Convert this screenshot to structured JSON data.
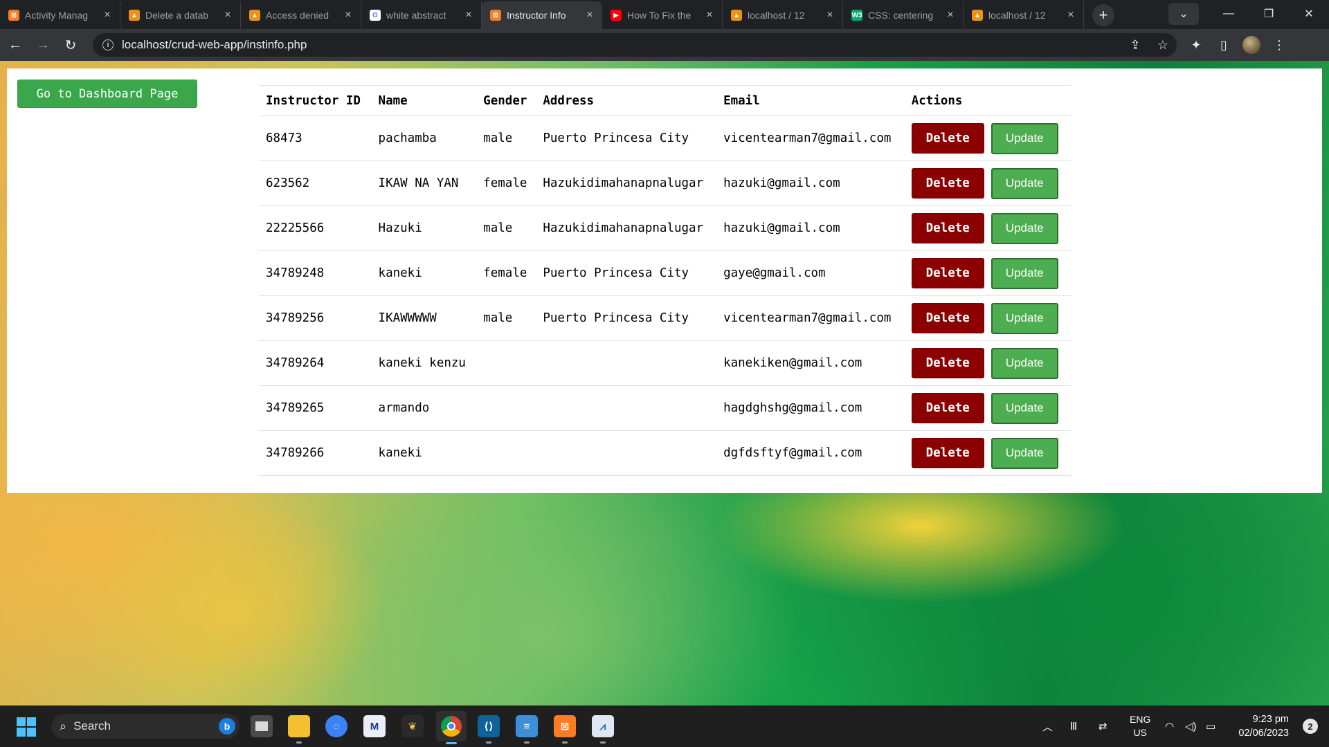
{
  "browser": {
    "tabs": [
      {
        "label": "Activity Manag",
        "favicon_color": "#fb7a24",
        "favicon_glyph": "⊠"
      },
      {
        "label": "Delete a datab",
        "favicon_color": "#f29111",
        "favicon_glyph": "▲"
      },
      {
        "label": "Access denied",
        "favicon_color": "#f29111",
        "favicon_glyph": "▲"
      },
      {
        "label": "white abstract",
        "favicon_color": "#ffffff",
        "favicon_glyph": "G"
      },
      {
        "label": "Instructor Info",
        "favicon_color": "#fb7a24",
        "favicon_glyph": "⊠",
        "active": true
      },
      {
        "label": "How To Fix the",
        "favicon_color": "#ff0000",
        "favicon_glyph": "▶"
      },
      {
        "label": "localhost / 12",
        "favicon_color": "#f29111",
        "favicon_glyph": "▲"
      },
      {
        "label": "CSS: centering",
        "favicon_color": "#04aa6d",
        "favicon_glyph": "W3"
      },
      {
        "label": "localhost / 12",
        "favicon_color": "#f29111",
        "favicon_glyph": "▲"
      }
    ],
    "url": "localhost/crud-web-app/instinfo.php"
  },
  "page": {
    "dashboard_button": "Go to Dashboard Page",
    "table": {
      "headers": [
        "Instructor ID",
        "Name",
        "Gender",
        "Address",
        "Email",
        "Actions"
      ],
      "rows": [
        {
          "id": "68473",
          "name": "pachamba",
          "gender": "male",
          "address": "Puerto Princesa City",
          "email": "vicentearman7@gmail.com"
        },
        {
          "id": "623562",
          "name": "IKAW NA YAN",
          "gender": "female",
          "address": "Hazukidimahanapnalugar",
          "email": "hazuki@gmail.com"
        },
        {
          "id": "22225566",
          "name": "Hazuki",
          "gender": "male",
          "address": "Hazukidimahanapnalugar",
          "email": "hazuki@gmail.com"
        },
        {
          "id": "34789248",
          "name": "kaneki",
          "gender": "female",
          "address": "Puerto Princesa City",
          "email": "gaye@gmail.com"
        },
        {
          "id": "34789256",
          "name": "IKAWWWWW",
          "gender": "male",
          "address": "Puerto Princesa City",
          "email": "vicentearman7@gmail.com"
        },
        {
          "id": "34789264",
          "name": "kaneki kenzu",
          "gender": "",
          "address": "",
          "email": "kanekiken@gmail.com"
        },
        {
          "id": "34789265",
          "name": "armando",
          "gender": "",
          "address": "",
          "email": "hagdghshg@gmail.com"
        },
        {
          "id": "34789266",
          "name": "kaneki",
          "gender": "",
          "address": "",
          "email": "dgfdsftyf@gmail.com"
        }
      ],
      "delete_label": "Delete",
      "update_label": "Update"
    }
  },
  "taskbar": {
    "search_placeholder": "Search",
    "apps": [
      "task-view",
      "file-explorer",
      "chat",
      "gmail-m",
      "corel",
      "chrome",
      "vscode",
      "notepad",
      "xampp",
      "task-manager"
    ],
    "lang_top": "ENG",
    "lang_bottom": "US",
    "time": "9:23 pm",
    "date": "02/06/2023",
    "notification_count": "2"
  },
  "colors": {
    "delete_bg": "#8b0000",
    "update_bg": "#4cae50",
    "dashboard_bg": "#3aa84a"
  }
}
